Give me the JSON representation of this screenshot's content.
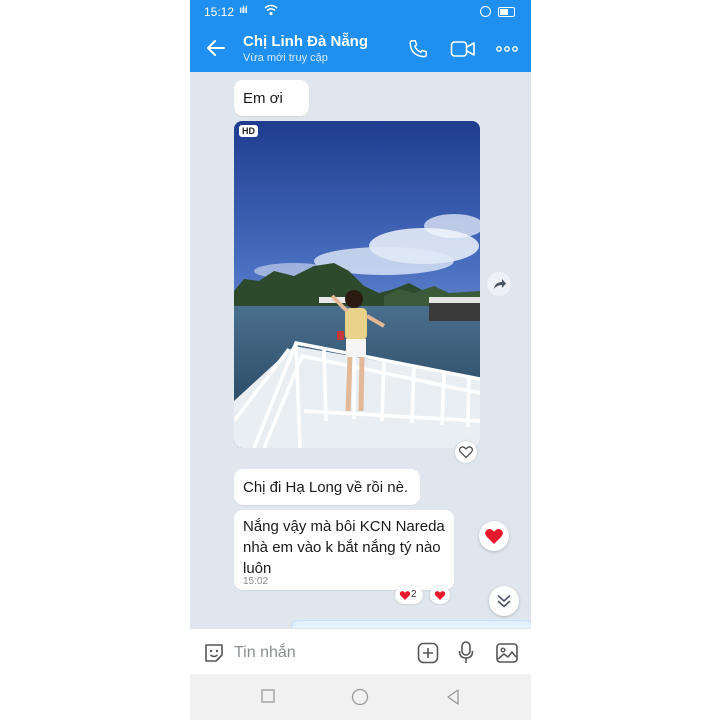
{
  "status_bar": {
    "time": "15:12",
    "signal": "ıılıl"
  },
  "header": {
    "contact_name": "Chị Linh Đà Nẵng",
    "status": "Vừa mới truy cập"
  },
  "messages": {
    "m1": "Em ơi",
    "photo_badge": "HD",
    "m2": "Chị đi Hạ Long về rồi nè.",
    "m3": "Nắng vậy mà bôi KCN Nareda nhà em vào k bắt nắng tý nào luôn",
    "m3_time": "15:02",
    "reaction_count": "2"
  },
  "input": {
    "placeholder": "Tin nhắn"
  },
  "colors": {
    "brand": "#1f8ff0",
    "chat_bg": "#dfe6ee",
    "heart": "#e8192c"
  }
}
